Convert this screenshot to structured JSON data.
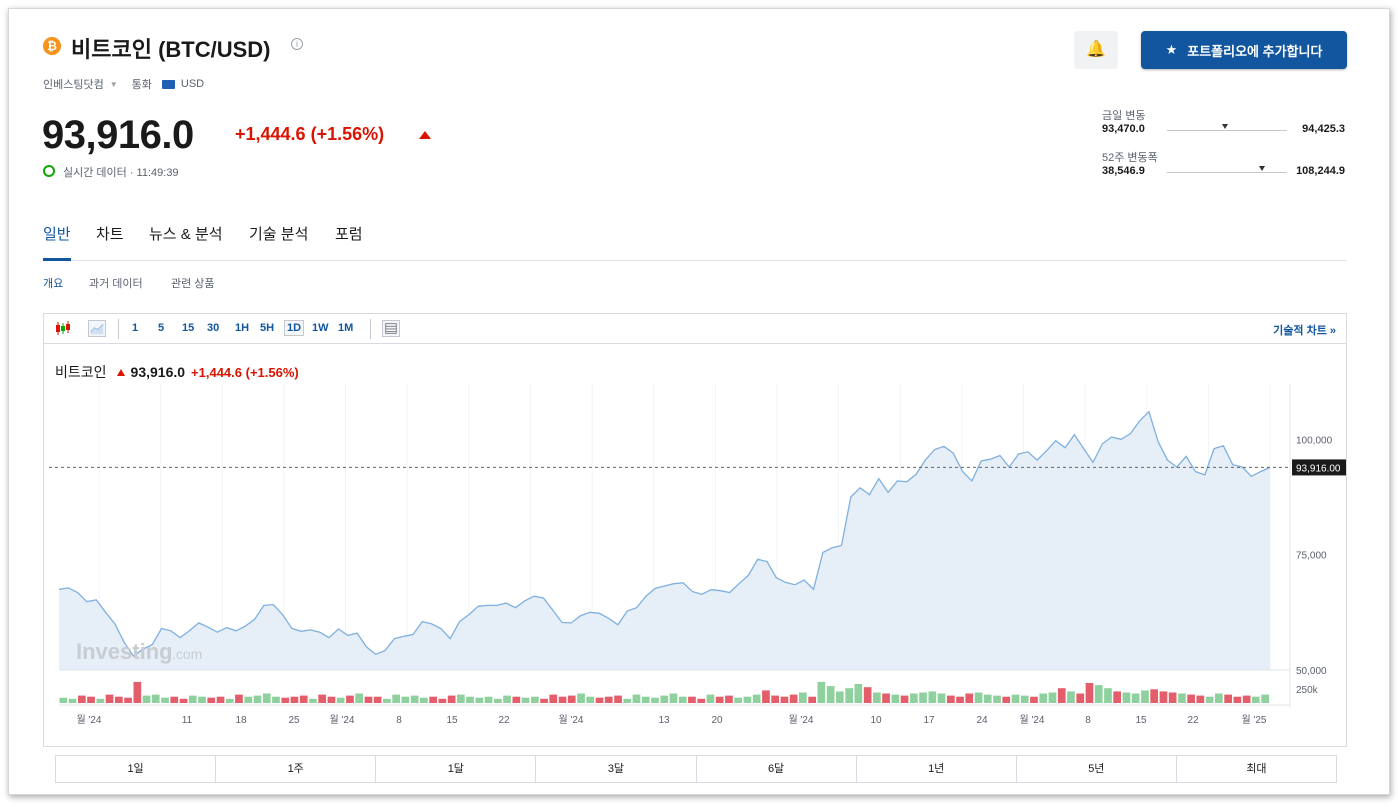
{
  "header": {
    "coin_symbol": "₿",
    "title": "비트코인 (BTC/USD)",
    "info_glyph": "i",
    "source": "인베스팅닷컴",
    "currency_label": "통화",
    "currency": "USD",
    "price": "93,916.0",
    "change": "+1,444.6 (+1.56%)",
    "realtime": "실시간 데이터 · 11:49:39",
    "bell_glyph": "🔔",
    "add_button": "포트폴리오에 추가합니다",
    "star_glyph": "★"
  },
  "ranges": {
    "day_label": "금일 변동",
    "day_low": "93,470.0",
    "day_high": "94,425.3",
    "day_position": 0.48,
    "week52_label": "52주 변동폭",
    "week52_low": "38,546.9",
    "week52_high": "108,244.9",
    "week52_position": 0.79
  },
  "tabs": [
    "일반",
    "차트",
    "뉴스 & 분석",
    "기술 분석",
    "포럼"
  ],
  "subtabs": [
    "개요",
    "과거 데이터",
    "관련 상품"
  ],
  "toolbar": {
    "intervals": [
      "1",
      "5",
      "15",
      "30",
      "1H",
      "5H",
      "1D",
      "1W",
      "1M"
    ],
    "selected": "1D",
    "tech_chart": "기술적 차트 »"
  },
  "legend": {
    "name": "비트코인",
    "price": "93,916.0",
    "change": "+1,444.6 (+1.56%)"
  },
  "watermark": "Investing",
  "watermark_suffix": ".com",
  "periods": [
    "1일",
    "1주",
    "1달",
    "3달",
    "6달",
    "1년",
    "5년",
    "최대"
  ],
  "colors": {
    "accent": "#1256a0",
    "down_red": "#d91400",
    "line": "#7fb0e0",
    "fill": "#e6eef8",
    "vol_red": "#e35d6a",
    "vol_green": "#8fd19e"
  },
  "chart_data": {
    "type": "area",
    "y_ticks": [
      "100,000",
      "75,000",
      "50,000"
    ],
    "ylim": [
      50000,
      112000
    ],
    "last_price_label": "93,916.00",
    "last_price": 93916,
    "volume_label": "250k",
    "x_tick_labels": [
      "월 '24",
      "11",
      "18",
      "25",
      "월 '24",
      "8",
      "15",
      "22",
      "월 '24",
      "13",
      "20",
      "월 '24",
      "10",
      "17",
      "24",
      "월 '24",
      "8",
      "15",
      "22",
      "월 '25"
    ],
    "values": [
      67500,
      67800,
      66800,
      64800,
      65200,
      62500,
      60000,
      56000,
      53000,
      54500,
      55500,
      59000,
      58500,
      57000,
      58500,
      60200,
      59300,
      58200,
      59200,
      58500,
      59500,
      61000,
      64000,
      64200,
      62000,
      59000,
      58400,
      58700,
      58200,
      57000,
      58900,
      57500,
      58000,
      55000,
      53400,
      54200,
      56800,
      57300,
      57700,
      60500,
      60000,
      59000,
      56800,
      60500,
      62000,
      63800,
      64000,
      64000,
      64500,
      63500,
      65000,
      66000,
      65600,
      63000,
      60300,
      60200,
      61800,
      62500,
      62300,
      61200,
      59800,
      62800,
      63500,
      66000,
      67700,
      68200,
      68700,
      68900,
      67000,
      66400,
      67400,
      67200,
      66800,
      68700,
      70500,
      74000,
      73500,
      70000,
      69000,
      68500,
      69500,
      67500,
      75500,
      76500,
      77000,
      87500,
      89500,
      88000,
      91500,
      88500,
      91000,
      90800,
      92400,
      95500,
      97800,
      98500,
      97000,
      93000,
      91000,
      95300,
      95700,
      96500,
      94000,
      96800,
      97300,
      95500,
      97500,
      99700,
      98200,
      101000,
      98000,
      95000,
      99000,
      100500,
      100000,
      101200,
      104000,
      106000,
      99500,
      95500,
      94000,
      96300,
      93000,
      92300,
      98000,
      98600,
      94500,
      94000,
      92000,
      93000,
      93916
    ],
    "volume_values": [
      0.25,
      0.2,
      0.35,
      0.3,
      0.2,
      0.4,
      0.3,
      0.25,
      1.0,
      0.35,
      0.4,
      0.25,
      0.3,
      0.2,
      0.35,
      0.3,
      0.25,
      0.3,
      0.2,
      0.4,
      0.3,
      0.35,
      0.45,
      0.3,
      0.25,
      0.3,
      0.35,
      0.2,
      0.4,
      0.3,
      0.25,
      0.35,
      0.45,
      0.3,
      0.3,
      0.2,
      0.4,
      0.3,
      0.35,
      0.25,
      0.3,
      0.2,
      0.35,
      0.4,
      0.3,
      0.25,
      0.3,
      0.2,
      0.35,
      0.3,
      0.25,
      0.3,
      0.2,
      0.4,
      0.3,
      0.35,
      0.45,
      0.3,
      0.25,
      0.3,
      0.35,
      0.2,
      0.4,
      0.3,
      0.25,
      0.35,
      0.45,
      0.3,
      0.3,
      0.2,
      0.4,
      0.3,
      0.35,
      0.25,
      0.3,
      0.4,
      0.6,
      0.35,
      0.3,
      0.4,
      0.5,
      0.3,
      1.0,
      0.8,
      0.55,
      0.7,
      0.9,
      0.75,
      0.5,
      0.45,
      0.4,
      0.35,
      0.45,
      0.5,
      0.55,
      0.45,
      0.35,
      0.3,
      0.45,
      0.5,
      0.4,
      0.35,
      0.3,
      0.4,
      0.35,
      0.3,
      0.45,
      0.5,
      0.7,
      0.55,
      0.45,
      0.95,
      0.85,
      0.7,
      0.55,
      0.5,
      0.45,
      0.6,
      0.65,
      0.55,
      0.5,
      0.45,
      0.4,
      0.35,
      0.3,
      0.45,
      0.4,
      0.3,
      0.35,
      0.3,
      0.4
    ]
  }
}
